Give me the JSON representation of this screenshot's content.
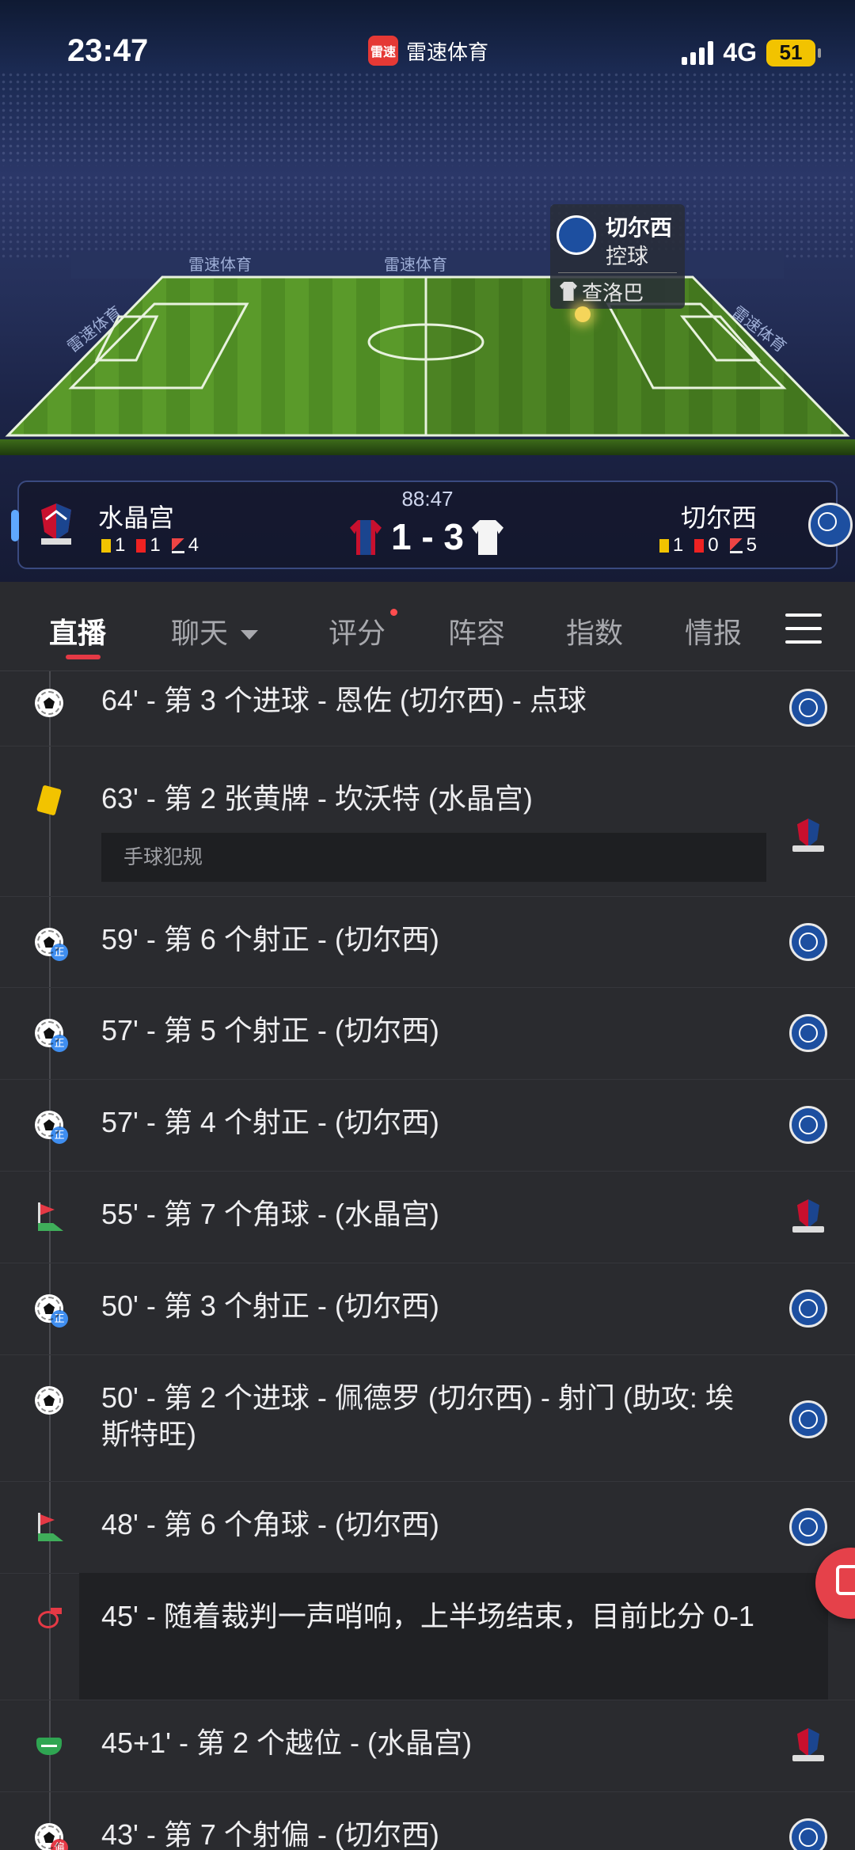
{
  "status_bar": {
    "time": "23:47",
    "app_logo_text": "雷速",
    "app_name": "雷速体育",
    "network": "4G",
    "battery": "51"
  },
  "stadium": {
    "ad_texts": [
      "雷速体育",
      "雷速体育",
      "雷速体育",
      "雷速体育"
    ],
    "possession": {
      "team": "切尔西",
      "action": "控球",
      "player": "查洛巴"
    }
  },
  "scoreboard": {
    "clock": "88:47",
    "score": "1 - 3",
    "home": {
      "name": "水晶宫",
      "yellow": "1",
      "red": "1",
      "corners": "4"
    },
    "away": {
      "name": "切尔西",
      "yellow": "1",
      "red": "0",
      "corners": "5"
    }
  },
  "tabs": {
    "live": "直播",
    "chat": "聊天",
    "rating": "评分",
    "lineup": "阵容",
    "odds": "指数",
    "intel": "情报"
  },
  "events": [
    {
      "text": "64' - 第 3 个进球 - 恩佐 (切尔西) - 点球",
      "type": "goal",
      "team": "chelsea"
    },
    {
      "text": "63' - 第 2 张黄牌 - 坎沃特 (水晶宫)",
      "note": "手球犯规",
      "type": "yellow",
      "team": "palace"
    },
    {
      "text": "59' - 第 6 个射正 - (切尔西)",
      "type": "shot-on",
      "team": "chelsea",
      "badge": "正"
    },
    {
      "text": "57' - 第 5 个射正 - (切尔西)",
      "type": "shot-on",
      "team": "chelsea",
      "badge": "正"
    },
    {
      "text": "57' - 第 4 个射正 - (切尔西)",
      "type": "shot-on",
      "team": "chelsea",
      "badge": "正"
    },
    {
      "text": "55' - 第 7 个角球 - (水晶宫)",
      "type": "corner",
      "team": "palace"
    },
    {
      "text": "50' - 第 3 个射正 - (切尔西)",
      "type": "shot-on",
      "team": "chelsea",
      "badge": "正"
    },
    {
      "text": "50' - 第 2 个进球 - 佩德罗 (切尔西) - 射门 (助攻: 埃斯特旺)",
      "type": "goal",
      "team": "chelsea"
    },
    {
      "text": "48' - 第 6 个角球 - (切尔西)",
      "type": "corner",
      "team": "chelsea"
    },
    {
      "text": "45' - 随着裁判一声哨响，上半场结束，目前比分 0-1",
      "type": "whistle"
    },
    {
      "text": "45+1' - 第 2 个越位 - (水晶宫)",
      "type": "offside",
      "team": "palace"
    },
    {
      "text": "43' - 第 7 个射偏 - (切尔西)",
      "type": "shot-off",
      "team": "chelsea",
      "badge": "偏"
    }
  ],
  "colors": {
    "accent": "#e53945",
    "background": "#2a2b2f",
    "battery": "#f2c300"
  }
}
